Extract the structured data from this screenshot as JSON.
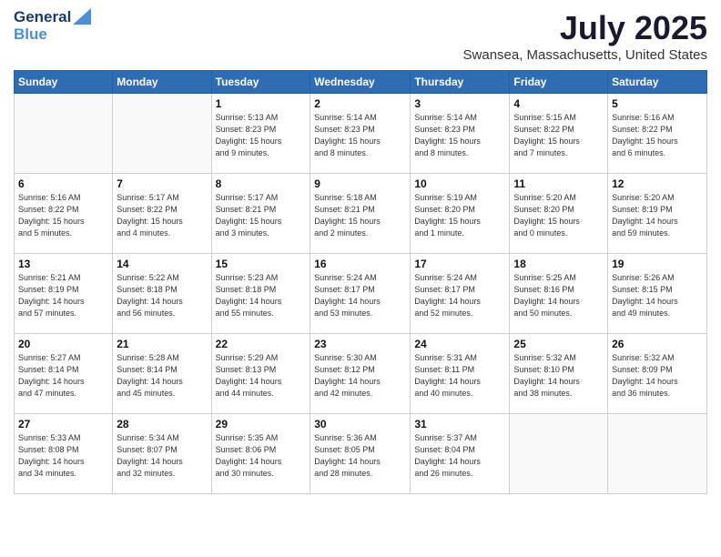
{
  "logo": {
    "line1": "General",
    "line2": "Blue"
  },
  "title": "July 2025",
  "subtitle": "Swansea, Massachusetts, United States",
  "days_of_week": [
    "Sunday",
    "Monday",
    "Tuesday",
    "Wednesday",
    "Thursday",
    "Friday",
    "Saturday"
  ],
  "weeks": [
    [
      {
        "day": "",
        "info": ""
      },
      {
        "day": "",
        "info": ""
      },
      {
        "day": "1",
        "info": "Sunrise: 5:13 AM\nSunset: 8:23 PM\nDaylight: 15 hours\nand 9 minutes."
      },
      {
        "day": "2",
        "info": "Sunrise: 5:14 AM\nSunset: 8:23 PM\nDaylight: 15 hours\nand 8 minutes."
      },
      {
        "day": "3",
        "info": "Sunrise: 5:14 AM\nSunset: 8:23 PM\nDaylight: 15 hours\nand 8 minutes."
      },
      {
        "day": "4",
        "info": "Sunrise: 5:15 AM\nSunset: 8:22 PM\nDaylight: 15 hours\nand 7 minutes."
      },
      {
        "day": "5",
        "info": "Sunrise: 5:16 AM\nSunset: 8:22 PM\nDaylight: 15 hours\nand 6 minutes."
      }
    ],
    [
      {
        "day": "6",
        "info": "Sunrise: 5:16 AM\nSunset: 8:22 PM\nDaylight: 15 hours\nand 5 minutes."
      },
      {
        "day": "7",
        "info": "Sunrise: 5:17 AM\nSunset: 8:22 PM\nDaylight: 15 hours\nand 4 minutes."
      },
      {
        "day": "8",
        "info": "Sunrise: 5:17 AM\nSunset: 8:21 PM\nDaylight: 15 hours\nand 3 minutes."
      },
      {
        "day": "9",
        "info": "Sunrise: 5:18 AM\nSunset: 8:21 PM\nDaylight: 15 hours\nand 2 minutes."
      },
      {
        "day": "10",
        "info": "Sunrise: 5:19 AM\nSunset: 8:20 PM\nDaylight: 15 hours\nand 1 minute."
      },
      {
        "day": "11",
        "info": "Sunrise: 5:20 AM\nSunset: 8:20 PM\nDaylight: 15 hours\nand 0 minutes."
      },
      {
        "day": "12",
        "info": "Sunrise: 5:20 AM\nSunset: 8:19 PM\nDaylight: 14 hours\nand 59 minutes."
      }
    ],
    [
      {
        "day": "13",
        "info": "Sunrise: 5:21 AM\nSunset: 8:19 PM\nDaylight: 14 hours\nand 57 minutes."
      },
      {
        "day": "14",
        "info": "Sunrise: 5:22 AM\nSunset: 8:18 PM\nDaylight: 14 hours\nand 56 minutes."
      },
      {
        "day": "15",
        "info": "Sunrise: 5:23 AM\nSunset: 8:18 PM\nDaylight: 14 hours\nand 55 minutes."
      },
      {
        "day": "16",
        "info": "Sunrise: 5:24 AM\nSunset: 8:17 PM\nDaylight: 14 hours\nand 53 minutes."
      },
      {
        "day": "17",
        "info": "Sunrise: 5:24 AM\nSunset: 8:17 PM\nDaylight: 14 hours\nand 52 minutes."
      },
      {
        "day": "18",
        "info": "Sunrise: 5:25 AM\nSunset: 8:16 PM\nDaylight: 14 hours\nand 50 minutes."
      },
      {
        "day": "19",
        "info": "Sunrise: 5:26 AM\nSunset: 8:15 PM\nDaylight: 14 hours\nand 49 minutes."
      }
    ],
    [
      {
        "day": "20",
        "info": "Sunrise: 5:27 AM\nSunset: 8:14 PM\nDaylight: 14 hours\nand 47 minutes."
      },
      {
        "day": "21",
        "info": "Sunrise: 5:28 AM\nSunset: 8:14 PM\nDaylight: 14 hours\nand 45 minutes."
      },
      {
        "day": "22",
        "info": "Sunrise: 5:29 AM\nSunset: 8:13 PM\nDaylight: 14 hours\nand 44 minutes."
      },
      {
        "day": "23",
        "info": "Sunrise: 5:30 AM\nSunset: 8:12 PM\nDaylight: 14 hours\nand 42 minutes."
      },
      {
        "day": "24",
        "info": "Sunrise: 5:31 AM\nSunset: 8:11 PM\nDaylight: 14 hours\nand 40 minutes."
      },
      {
        "day": "25",
        "info": "Sunrise: 5:32 AM\nSunset: 8:10 PM\nDaylight: 14 hours\nand 38 minutes."
      },
      {
        "day": "26",
        "info": "Sunrise: 5:32 AM\nSunset: 8:09 PM\nDaylight: 14 hours\nand 36 minutes."
      }
    ],
    [
      {
        "day": "27",
        "info": "Sunrise: 5:33 AM\nSunset: 8:08 PM\nDaylight: 14 hours\nand 34 minutes."
      },
      {
        "day": "28",
        "info": "Sunrise: 5:34 AM\nSunset: 8:07 PM\nDaylight: 14 hours\nand 32 minutes."
      },
      {
        "day": "29",
        "info": "Sunrise: 5:35 AM\nSunset: 8:06 PM\nDaylight: 14 hours\nand 30 minutes."
      },
      {
        "day": "30",
        "info": "Sunrise: 5:36 AM\nSunset: 8:05 PM\nDaylight: 14 hours\nand 28 minutes."
      },
      {
        "day": "31",
        "info": "Sunrise: 5:37 AM\nSunset: 8:04 PM\nDaylight: 14 hours\nand 26 minutes."
      },
      {
        "day": "",
        "info": ""
      },
      {
        "day": "",
        "info": ""
      }
    ]
  ],
  "colors": {
    "header_bg": "#2e6db4",
    "header_text": "#ffffff",
    "logo_dark": "#1a3a6c",
    "logo_blue": "#4a90d9"
  }
}
